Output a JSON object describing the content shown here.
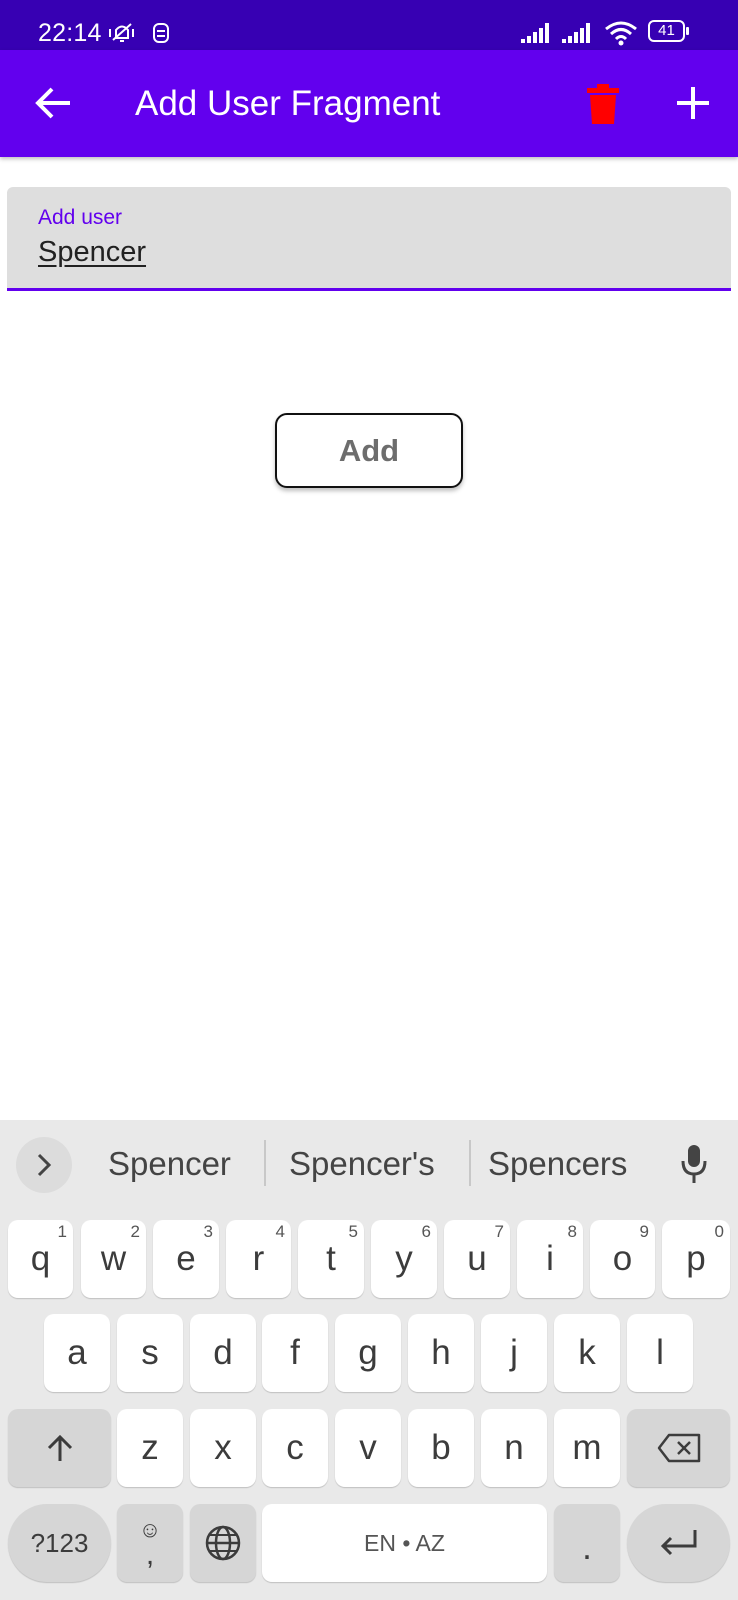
{
  "status_bar": {
    "time": "22:14",
    "battery": "41",
    "icons": [
      "vibrate-muted-icon",
      "sim-icon",
      "signal-icon",
      "signal-icon",
      "wifi-icon",
      "battery-icon"
    ]
  },
  "app_bar": {
    "title": "Add User Fragment",
    "back_icon": "arrow-left-icon",
    "delete_icon": "trash-icon",
    "add_icon": "plus-icon",
    "colors": {
      "background": "#6200ee",
      "status_bar": "#3700b3",
      "delete_icon": "#ff0000"
    }
  },
  "form": {
    "field_label": "Add user",
    "field_value": "Spencer",
    "button_label": "Add",
    "accent_color": "#6200ee"
  },
  "keyboard": {
    "suggestions": [
      "Spencer",
      "Spencer's",
      "Spencers"
    ],
    "row1": [
      {
        "key": "q",
        "hint": "1"
      },
      {
        "key": "w",
        "hint": "2"
      },
      {
        "key": "e",
        "hint": "3"
      },
      {
        "key": "r",
        "hint": "4"
      },
      {
        "key": "t",
        "hint": "5"
      },
      {
        "key": "y",
        "hint": "6"
      },
      {
        "key": "u",
        "hint": "7"
      },
      {
        "key": "i",
        "hint": "8"
      },
      {
        "key": "o",
        "hint": "9"
      },
      {
        "key": "p",
        "hint": "0"
      }
    ],
    "row2": [
      "a",
      "s",
      "d",
      "f",
      "g",
      "h",
      "j",
      "k",
      "l"
    ],
    "row3": [
      "z",
      "x",
      "c",
      "v",
      "b",
      "n",
      "m"
    ],
    "symbols_label": "?123",
    "comma_label": ",",
    "space_label": "EN • AZ",
    "period_label": "."
  }
}
